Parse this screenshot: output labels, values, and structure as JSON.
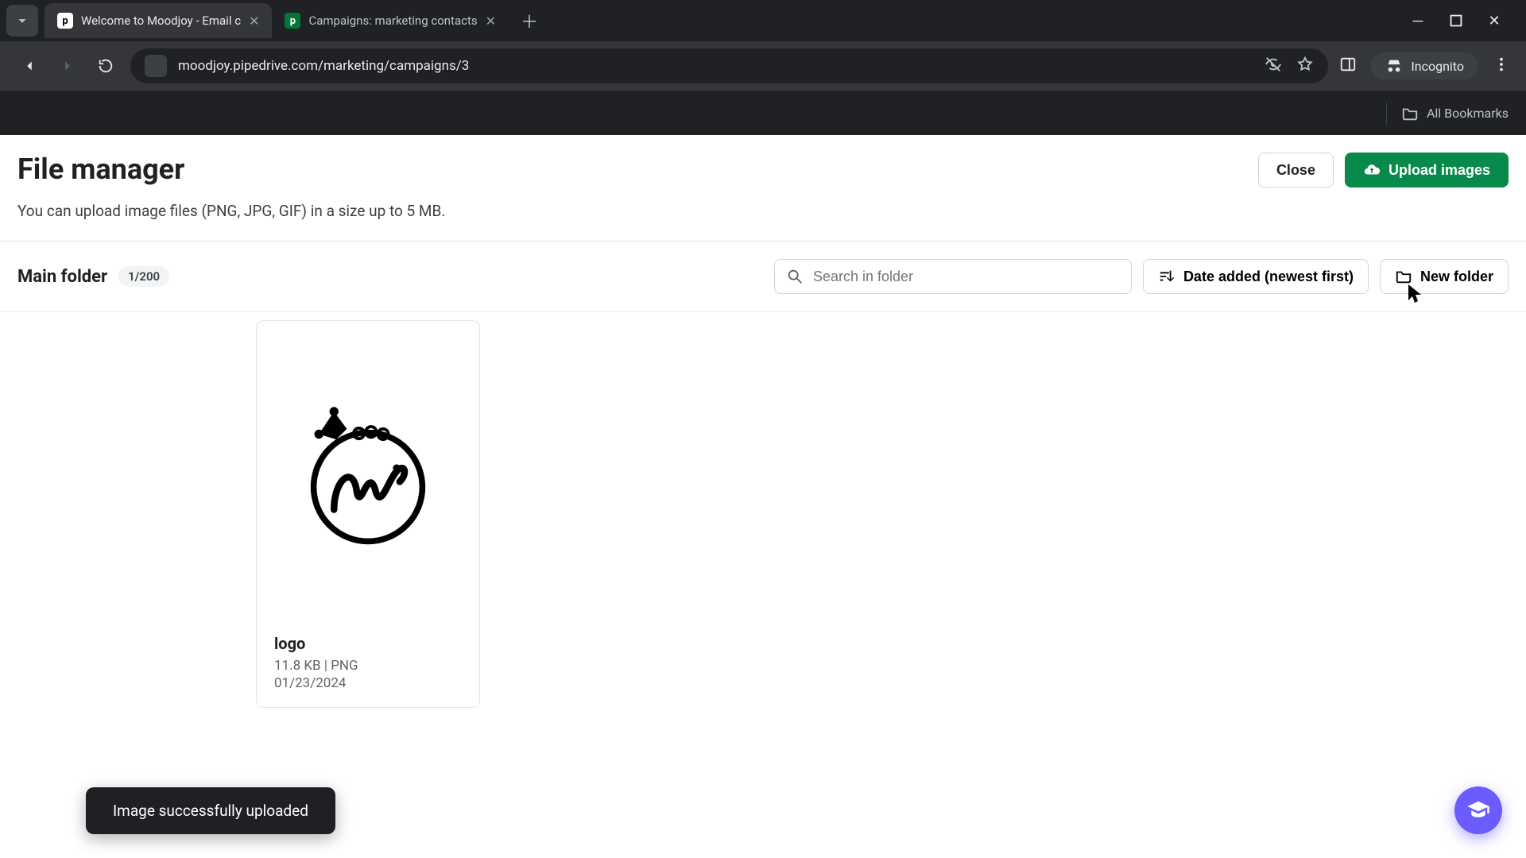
{
  "browser": {
    "tabs": [
      {
        "title": "Welcome to Moodjoy - Email c",
        "active": true
      },
      {
        "title": "Campaigns: marketing contacts",
        "active": false
      }
    ],
    "url": "moodjoy.pipedrive.com/marketing/campaigns/3",
    "incognito_label": "Incognito",
    "all_bookmarks_label": "All Bookmarks"
  },
  "header": {
    "title": "File manager",
    "close_label": "Close",
    "upload_label": "Upload images"
  },
  "subtitle": "You can upload image files (PNG, JPG, GIF) in a size up to 5 MB.",
  "toolbar": {
    "folder_name": "Main folder",
    "count": "1/200",
    "search_placeholder": "Search in folder",
    "sort_label": "Date added (newest first)",
    "new_folder_label": "New folder"
  },
  "files": [
    {
      "name": "logo",
      "meta": "11.8 KB | PNG",
      "date": "01/23/2024"
    }
  ],
  "toast": "Image successfully uploaded",
  "colors": {
    "primary": "#088a4b",
    "fab": "#6a5cff"
  }
}
